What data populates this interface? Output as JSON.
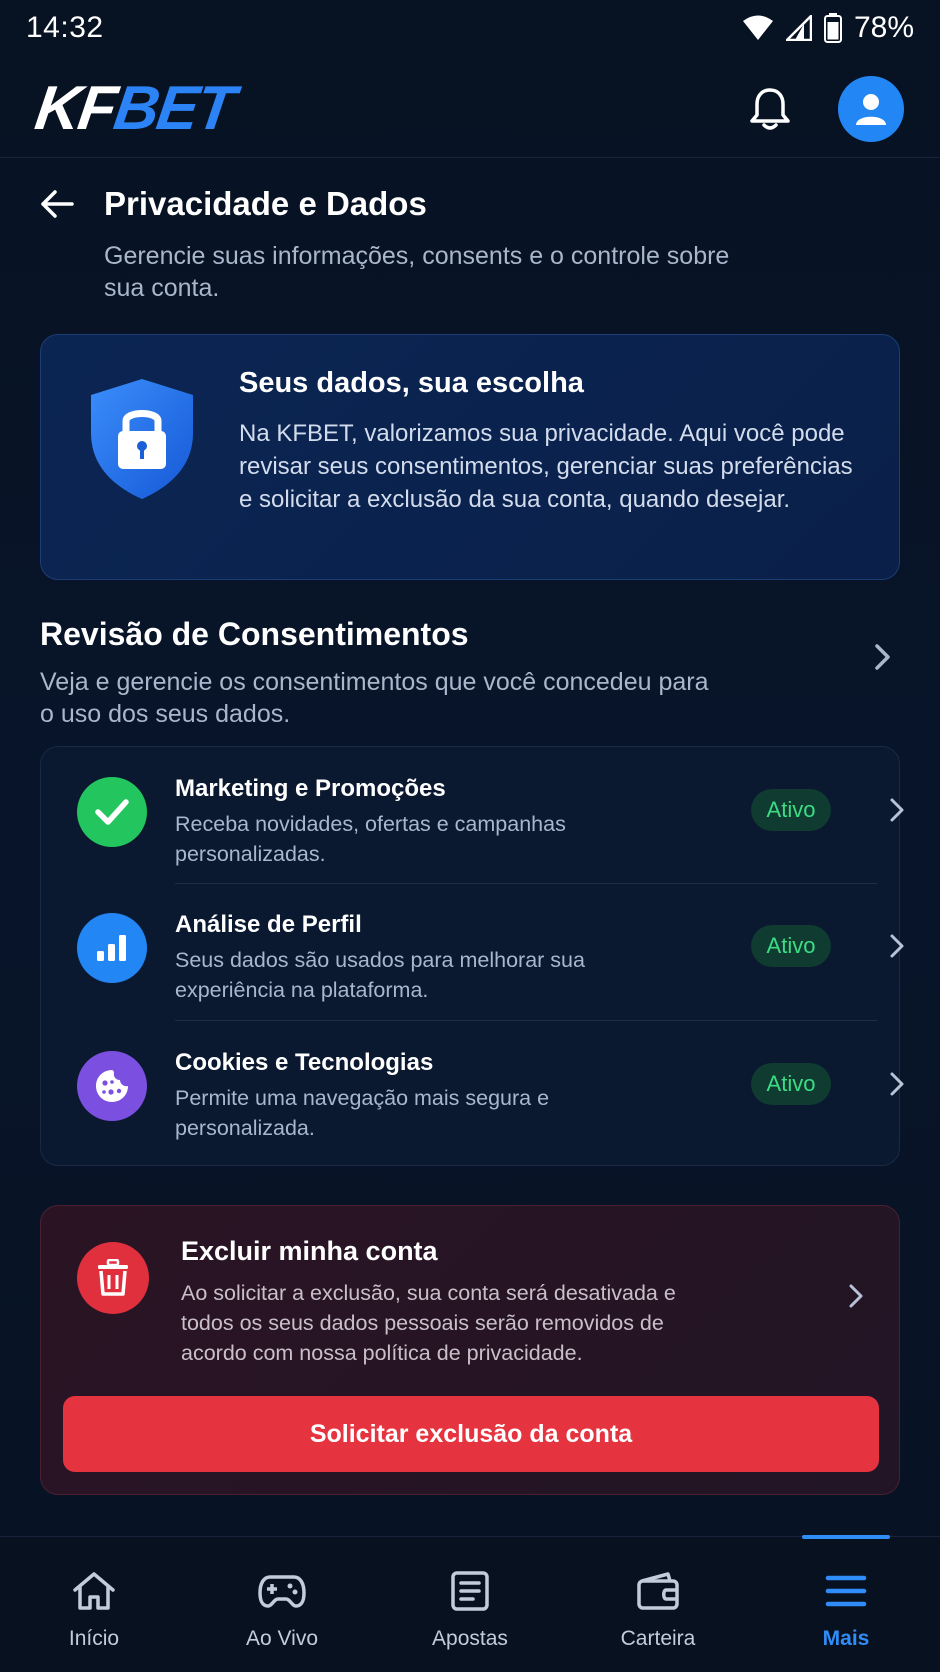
{
  "status_bar": {
    "time": "14:32",
    "battery": "78%"
  },
  "header": {
    "logo_part1": "KF",
    "logo_part2": "BET"
  },
  "page": {
    "title": "Privacidade e Dados",
    "subtitle": "Gerencie suas informações, consents e o controle sobre sua conta."
  },
  "hero": {
    "title": "Seus dados, sua escolha",
    "text": "Na KFBET, valorizamos sua privacidade. Aqui você pode revisar seus consentimentos, gerenciar suas preferências e solicitar a exclusão da sua conta, quando desejar."
  },
  "consents": {
    "title": "Revisão de Consentimentos",
    "subtitle": "Veja e gerencie os consentimentos que você concedeu para o uso dos seus dados.",
    "items": [
      {
        "title": "Marketing e Promoções",
        "desc": "Receba novidades, ofertas e campanhas personalizadas.",
        "status": "Ativo",
        "icon": "check-icon",
        "color": "#22c55e"
      },
      {
        "title": "Análise de Perfil",
        "desc": "Seus dados são usados para melhorar sua experiência na plataforma.",
        "status": "Ativo",
        "icon": "bar-chart-icon",
        "color": "#2386f5"
      },
      {
        "title": "Cookies e Tecnologias",
        "desc": "Permite uma navegação mais segura e personalizada.",
        "status": "Ativo",
        "icon": "cookie-icon",
        "color": "#7b4fe0"
      }
    ]
  },
  "delete_account": {
    "title": "Excluir minha conta",
    "text": "Ao solicitar a exclusão, sua conta será desativada e todos os seus dados pessoais serão removidos de acordo com nossa política de privacidade.",
    "button": "Solicitar exclusão da conta"
  },
  "bottom_nav": {
    "items": [
      {
        "label": "Início",
        "icon": "home-icon"
      },
      {
        "label": "Ao Vivo",
        "icon": "gamepad-icon"
      },
      {
        "label": "Apostas",
        "icon": "ticket-icon"
      },
      {
        "label": "Carteira",
        "icon": "wallet-icon"
      },
      {
        "label": "Mais",
        "icon": "menu-icon",
        "active": true
      }
    ]
  },
  "colors": {
    "accent": "#2f8cf8",
    "danger": "#e5333f",
    "success": "#3ddc84"
  }
}
